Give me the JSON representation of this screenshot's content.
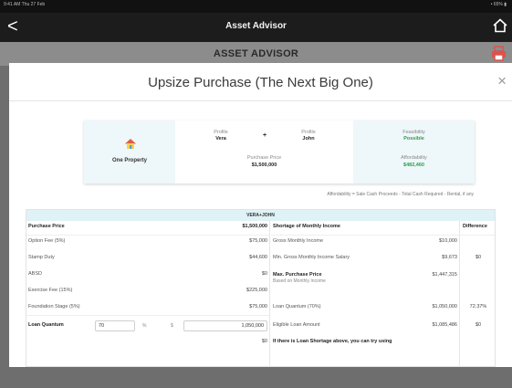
{
  "status": {
    "left": "9:41 AM  Thu 27 Feb",
    "right": "• 65% ▮"
  },
  "nav": {
    "back_glyph": "<",
    "title": "Asset Advisor",
    "home_icon": "home-icon"
  },
  "header": {
    "title": "ASSET ADVISOR",
    "print_icon": "printer-icon",
    "accent": "#d9534f"
  },
  "modal": {
    "title": "Upsize Purchase (The Next Big One)",
    "close_glyph": "×"
  },
  "summary": {
    "property_label": "One Property",
    "profile_label": "Profile",
    "profile1": "Vera",
    "plus": "+",
    "profile2": "John",
    "purchase_price_label": "Purchase Price",
    "purchase_price": "$1,500,000",
    "feasibility_label": "Feasibility",
    "feasibility": "Possible",
    "affordability_label": "Affordability",
    "affordability": "$482,460",
    "positive_color": "#2e9e48"
  },
  "note": "Affordability = Sale Cash Proceeds - Total Cash Required - Rental, if any",
  "table": {
    "band": "VERA+JOHN",
    "left": [
      {
        "label": "Purchase Price",
        "value": "$1,500,000",
        "bold": true
      },
      {
        "label": "Option Fee (5%)",
        "value": "$75,000"
      },
      {
        "label": "Stamp Duty",
        "value": "$44,600"
      },
      {
        "label": "ABSD",
        "value": "$0"
      },
      {
        "label": "Exercise Fee (15%)",
        "value": "$225,000"
      },
      {
        "label": "Foundation Stage (5%)",
        "value": "$75,000"
      }
    ],
    "loan_quantum": {
      "label": "Loan Quantum",
      "percent": "70",
      "percent_sign": "%",
      "currency": "$",
      "amount": "1,050,000"
    },
    "right_header": {
      "label": "Shortage of Monthly Income",
      "difference": "Difference"
    },
    "right": [
      {
        "label": "Gross Monthly Income",
        "value": "$10,000",
        "diff": ""
      },
      {
        "label": "Min. Gross Monthly Income Salary",
        "value": "$9,673",
        "diff": "$0"
      },
      {
        "label": "Max. Purchase Price",
        "sub": "Based on Monthly Income",
        "value": "$1,447,315",
        "diff": ""
      },
      {
        "label": "Loan Quantum (70%)",
        "value": "$1,050,000",
        "diff": "72.37%"
      },
      {
        "label": "Eligible Loan Amount",
        "value": "$1,085,486",
        "diff": "$0"
      },
      {
        "label": "If there is Loan Shortage above, you can try using",
        "value": "",
        "diff": ""
      }
    ],
    "cutoff_value": "$0"
  }
}
